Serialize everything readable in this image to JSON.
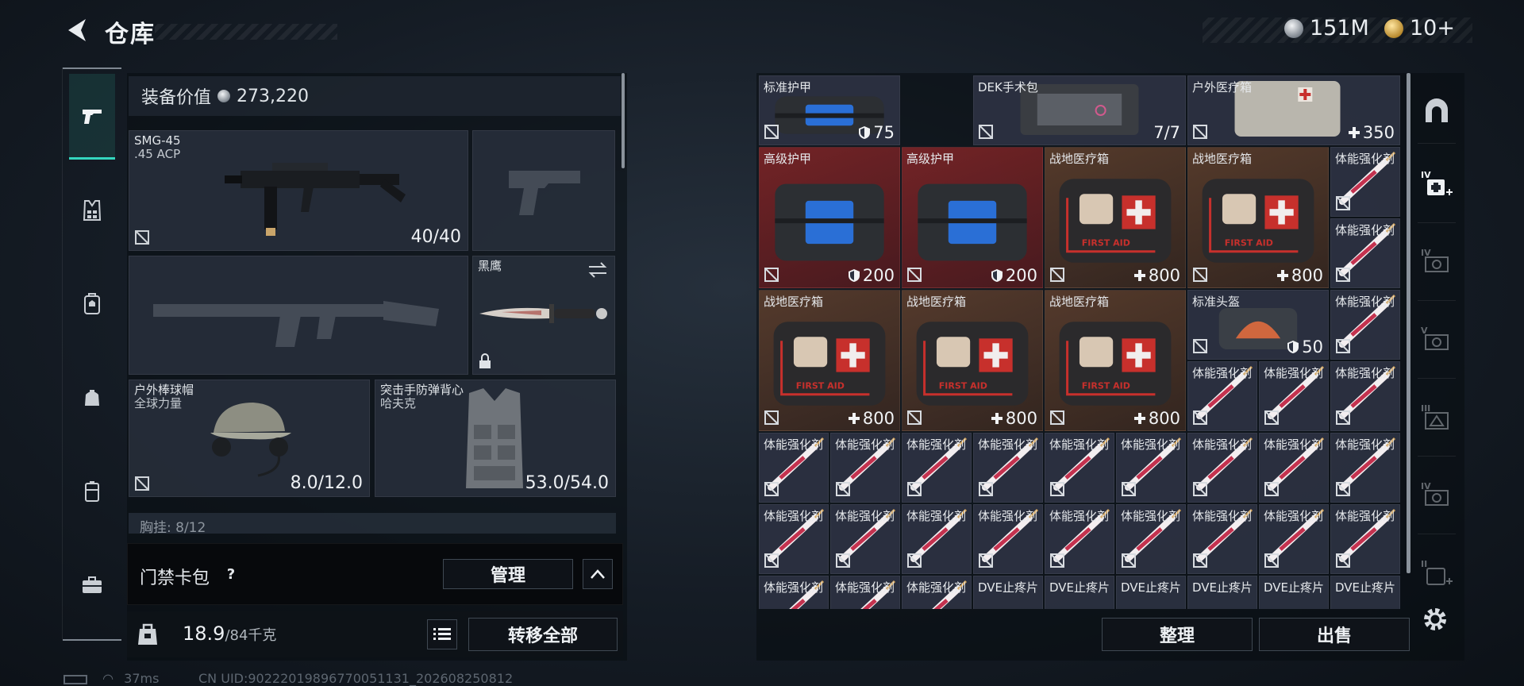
{
  "header": {
    "title": "仓库",
    "currency_1": "151M",
    "currency_2": "10+"
  },
  "sidebar_left": {
    "items": [
      {
        "icon": "pistol-icon",
        "active": true
      },
      {
        "icon": "vest-icon",
        "active": false
      },
      {
        "icon": "backpack-icon",
        "active": false
      },
      {
        "icon": "pouch-icon",
        "active": false
      },
      {
        "icon": "case-icon",
        "active": false
      },
      {
        "icon": "toolbox-icon",
        "active": false
      }
    ]
  },
  "equipment": {
    "value_label": "装备价值",
    "value": "273,220",
    "primary_weapon": {
      "name": "SMG-45",
      "ammo": ".45 ACP",
      "value": "40/40"
    },
    "melee": {
      "name": "黑鹰"
    },
    "helmet": {
      "name": "户外棒球帽",
      "sub": "全球力量",
      "value": "8.0/12.0"
    },
    "armor": {
      "name": "突击手防弹背心",
      "sub": "哈夫克",
      "value": "53.0/54.0"
    },
    "chest_rig_partial": "胸挂: 8/12"
  },
  "keycard": {
    "label": "门禁卡包",
    "help": "?",
    "manage_label": "管理"
  },
  "capacity": {
    "current": "18.9",
    "max": "/84千克",
    "transfer_all_label": "转移全部"
  },
  "status": {
    "ping": "37ms",
    "uid": "CN UID:90222019896770051131_202608250812"
  },
  "stash": {
    "sort_label": "整理",
    "sell_label": "出售",
    "items": [
      {
        "name": "标准护甲",
        "value": "75",
        "kind": "armor"
      },
      {
        "name": "DEK手术包",
        "value": "7/7",
        "kind": "surgery"
      },
      {
        "name": "户外医疗箱",
        "value": "350",
        "kind": "medbox"
      },
      {
        "name": "高级护甲",
        "value": "200",
        "kind": "armor"
      },
      {
        "name": "高级护甲",
        "value": "200",
        "kind": "armor"
      },
      {
        "name": "战地医疗箱",
        "value": "800",
        "kind": "firstaid"
      },
      {
        "name": "战地医疗箱",
        "value": "800",
        "kind": "firstaid"
      },
      {
        "name": "战地医疗箱",
        "value": "800",
        "kind": "firstaid"
      },
      {
        "name": "战地医疗箱",
        "value": "800",
        "kind": "firstaid"
      },
      {
        "name": "战地医疗箱",
        "value": "800",
        "kind": "firstaid"
      },
      {
        "name": "标准头盔",
        "value": "50",
        "kind": "helmet"
      },
      {
        "name": "体能强化剂",
        "kind": "injector"
      },
      {
        "name": "DVE止疼片",
        "kind": "pill"
      }
    ],
    "first_aid_text": "FIRST AID"
  }
}
